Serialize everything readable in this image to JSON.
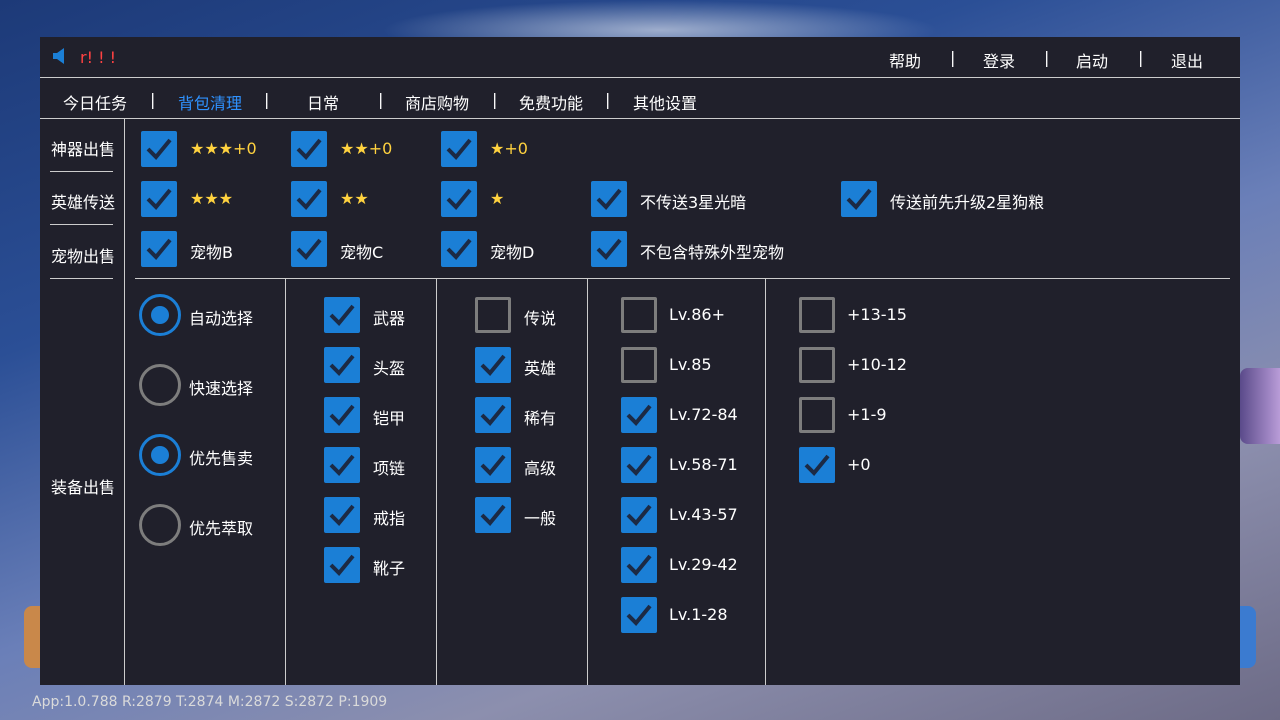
{
  "topbar": {
    "alert": "r! ! !",
    "menu": [
      "帮助",
      "登录",
      "启动",
      "退出"
    ],
    "separator": "|"
  },
  "tabs": [
    "今日任务",
    "背包清理",
    "日常",
    "商店购物",
    "免费功能",
    "其他设置"
  ],
  "active_tab": "背包清理",
  "sidebar": [
    "神器出售",
    "英雄传送",
    "宠物出售",
    "装备出售"
  ],
  "artifact_sell": [
    {
      "label": "★★★+0",
      "checked": true
    },
    {
      "label": "★★+0",
      "checked": true
    },
    {
      "label": "★+0",
      "checked": true
    }
  ],
  "hero_transfer": [
    {
      "label": "★★★",
      "checked": true
    },
    {
      "label": "★★",
      "checked": true
    },
    {
      "label": "★",
      "checked": true
    },
    {
      "label": "不传送3星光暗",
      "checked": true
    },
    {
      "label": "传送前先升级2星狗粮",
      "checked": true
    }
  ],
  "pet_sell": [
    {
      "label": "宠物B",
      "checked": true
    },
    {
      "label": "宠物C",
      "checked": true
    },
    {
      "label": "宠物D",
      "checked": true
    },
    {
      "label": "不包含特殊外型宠物",
      "checked": true
    }
  ],
  "equip_modes": [
    {
      "label": "自动选择",
      "selected": true
    },
    {
      "label": "快速选择",
      "selected": false
    },
    {
      "label": "优先售卖",
      "selected": true
    },
    {
      "label": "优先萃取",
      "selected": false
    }
  ],
  "equip_types": [
    {
      "label": "武器",
      "checked": true
    },
    {
      "label": "头盔",
      "checked": true
    },
    {
      "label": "铠甲",
      "checked": true
    },
    {
      "label": "项链",
      "checked": true
    },
    {
      "label": "戒指",
      "checked": true
    },
    {
      "label": "靴子",
      "checked": true
    }
  ],
  "equip_rarity": [
    {
      "label": "传说",
      "checked": false
    },
    {
      "label": "英雄",
      "checked": true
    },
    {
      "label": "稀有",
      "checked": true
    },
    {
      "label": "高级",
      "checked": true
    },
    {
      "label": "一般",
      "checked": true
    }
  ],
  "equip_level": [
    {
      "label": "Lv.86+",
      "checked": false
    },
    {
      "label": "Lv.85",
      "checked": false
    },
    {
      "label": "Lv.72-84",
      "checked": true
    },
    {
      "label": "Lv.58-71",
      "checked": true
    },
    {
      "label": "Lv.43-57",
      "checked": true
    },
    {
      "label": "Lv.29-42",
      "checked": true
    },
    {
      "label": "Lv.1-28",
      "checked": true
    }
  ],
  "equip_enhance": [
    {
      "label": "+13-15",
      "checked": false
    },
    {
      "label": "+10-12",
      "checked": false
    },
    {
      "label": "+1-9",
      "checked": false
    },
    {
      "label": "+0",
      "checked": true
    }
  ],
  "footer": "App:1.0.788  R:2879 T:2874 M:2872 S:2872 P:1909",
  "colors": {
    "accent": "#1b7fd6",
    "active_tab": "#2f92ff",
    "alert": "#ff4242",
    "star": "#ffd23f",
    "panel": "#20202b"
  }
}
